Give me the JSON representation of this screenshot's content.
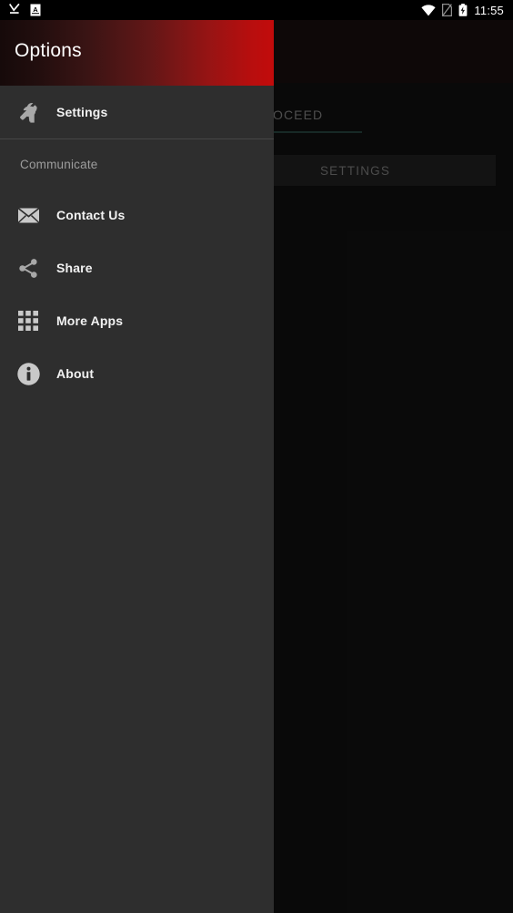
{
  "status_bar": {
    "left_icons": [
      {
        "name": "download-complete-icon",
        "label": "download complete"
      },
      {
        "name": "app-notification-icon",
        "label": "A"
      }
    ],
    "right_icons": [
      {
        "name": "wifi-icon",
        "label": "wifi"
      },
      {
        "name": "no-sim-icon",
        "label": "no sim"
      },
      {
        "name": "battery-charging-icon",
        "label": "battery charging"
      }
    ],
    "clock": "11:55"
  },
  "background": {
    "proceed_text": "R TO PROCEED",
    "settings_button_label": "SETTINGS"
  },
  "drawer": {
    "title": "Options",
    "items": [
      {
        "label": "Settings",
        "icon": "wrench-icon",
        "key": "settings"
      }
    ],
    "section_label": "Communicate",
    "communicate_items": [
      {
        "label": "Contact Us",
        "icon": "envelope-icon",
        "key": "contact-us"
      },
      {
        "label": "Share",
        "icon": "share-icon",
        "key": "share"
      },
      {
        "label": "More Apps",
        "icon": "grid-apps-icon",
        "key": "more-apps"
      },
      {
        "label": "About",
        "icon": "info-circle-icon",
        "key": "about"
      }
    ]
  },
  "colors": {
    "drawer_bg": "#2e2e2e",
    "app_bg": "#121212",
    "accent_red": "#c20b0b",
    "accent_teal": "#2b4c46",
    "label": "#f2f2f2",
    "muted": "#9d9d9d"
  }
}
